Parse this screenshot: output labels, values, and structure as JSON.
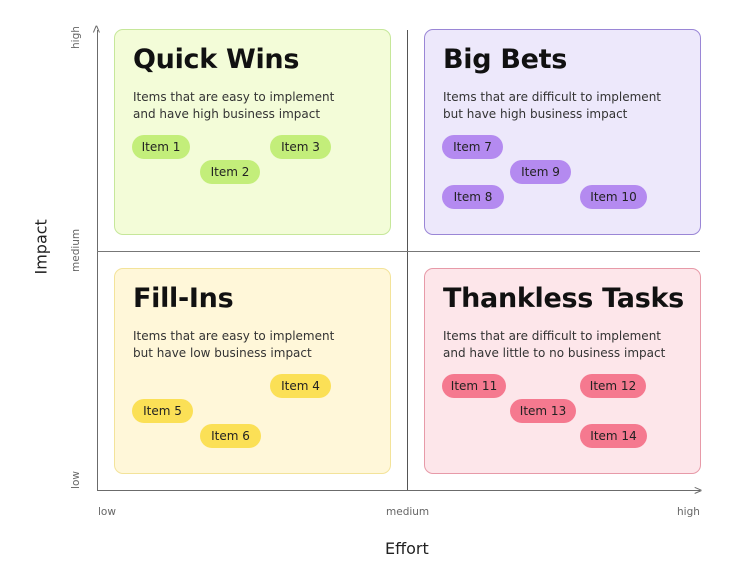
{
  "axes": {
    "y_title": "Impact",
    "x_title": "Effort",
    "y_ticks": [
      "high",
      "medium",
      "low"
    ],
    "x_ticks": [
      "low",
      "medium",
      "high"
    ]
  },
  "colors": {
    "quick_wins_bg": "#f3fcd8",
    "quick_wins_border": "#c6e79a",
    "quick_wins_pill": "#c3ee7a",
    "big_bets_bg": "#ede8fb",
    "big_bets_border": "#9a86d6",
    "big_bets_pill": "#b48af0",
    "fill_ins_bg": "#fff7d9",
    "fill_ins_border": "#f3e39a",
    "fill_ins_pill": "#fbe056",
    "thankless_bg": "#fde6ea",
    "thankless_border": "#e79aa8",
    "thankless_pill": "#f5798f"
  },
  "quadrants": [
    {
      "id": "quick-wins",
      "title": "Quick Wins",
      "desc_line1": "Items that are easy to implement",
      "desc_line2": "and have high business impact",
      "effort": "low",
      "impact": "high",
      "items": [
        "Item 1",
        "Item 2",
        "Item 3"
      ]
    },
    {
      "id": "big-bets",
      "title": "Big Bets",
      "desc_line1": "Items that are difficult to implement",
      "desc_line2": "but have high business impact",
      "effort": "high",
      "impact": "high",
      "items": [
        "Item 7",
        "Item 9",
        "Item 8",
        "Item 10"
      ]
    },
    {
      "id": "fill-ins",
      "title": "Fill-Ins",
      "desc_line1": "Items that are easy to implement",
      "desc_line2": "but have low business impact",
      "effort": "low",
      "impact": "low",
      "items": [
        "Item 4",
        "Item 5",
        "Item 6"
      ]
    },
    {
      "id": "thankless-tasks",
      "title": "Thankless Tasks",
      "desc_line1": "Items that are difficult to implement",
      "desc_line2": "and have little to no business impact",
      "effort": "high",
      "impact": "low",
      "items": [
        "Item 11",
        "Item 12",
        "Item 13",
        "Item 14"
      ]
    }
  ]
}
